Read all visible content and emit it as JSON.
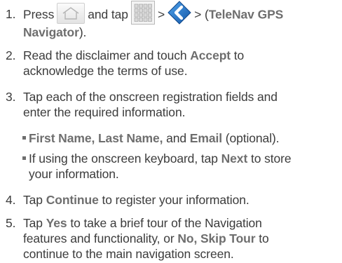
{
  "steps": [
    {
      "num": "1.",
      "press": "Press",
      "and_tap": "and tap",
      "gt1": ">",
      "gt2": ">",
      "paren_open": "(",
      "app_name": "TeleNav GPS Navigator",
      "paren_close": ")."
    },
    {
      "num": "2.",
      "line1_a": "Read the disclaimer and touch",
      "line1_bold": "Accept",
      "line1_b": "to",
      "line2": "acknowledge the terms of use."
    },
    {
      "num": "3.",
      "line1": "Tap each of the onscreen registration fields and",
      "line2": "enter the required information."
    },
    {
      "num": "4.",
      "a": "Tap",
      "bold": "Continue",
      "b": "to register your information."
    },
    {
      "num": "5.",
      "line1_a": "Tap",
      "line1_bold": "Yes",
      "line1_b": "to take a brief tour of the Navigation",
      "line2_a": "features and functionality, or",
      "line2_bold": "No, Skip Tour",
      "line2_b": "to",
      "line3": "continue to the main navigation screen."
    }
  ],
  "bullets": [
    {
      "bold1": "First Name, Last Name,",
      "and": "and",
      "bold2": "Email",
      "rest": "(optional)."
    },
    {
      "line1_a": "If using the onscreen keyboard, tap",
      "line1_bold": "Next",
      "line1_b": "to store",
      "line2": "your information."
    }
  ],
  "icons": {
    "home": "home-icon",
    "apps": "apps-grid-icon",
    "telenav": "telenav-app-icon",
    "accent": "#1e6fc4"
  }
}
